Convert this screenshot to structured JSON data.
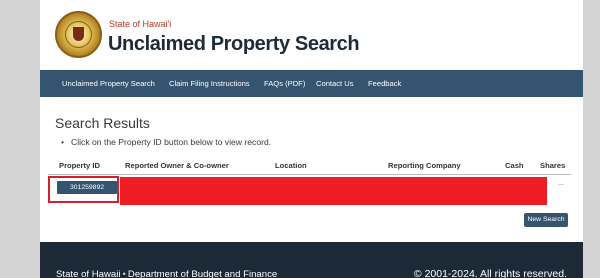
{
  "header": {
    "state_line": "State of Hawai'i",
    "title": "Unclaimed Property Search"
  },
  "nav": {
    "items": [
      {
        "label": "Unclaimed Property Search"
      },
      {
        "label": "Claim Filing Instructions"
      },
      {
        "label": "FAQs (PDF)"
      },
      {
        "label": "Contact Us"
      },
      {
        "label": "Feedback"
      }
    ]
  },
  "results": {
    "title": "Search Results",
    "hint": "Click on the Property ID button below to view record.",
    "columns": [
      "Property ID",
      "Reported Owner & Co-owner",
      "Location",
      "Reporting Company",
      "Cash",
      "Shares"
    ],
    "rows": [
      {
        "property_id": "301259892",
        "shares": "..."
      }
    ],
    "new_search_label": "New Search"
  },
  "footer": {
    "left_part1": "State of Hawaii",
    "separator": "•",
    "left_part2": "Department of Budget and Finance",
    "copyright": "© 2001-2024. All rights reserved."
  },
  "colors": {
    "nav_bg": "#34546f",
    "footer_bg": "#1b2a36",
    "redaction": "#ee1c25",
    "highlight_border": "#d61f2c"
  }
}
